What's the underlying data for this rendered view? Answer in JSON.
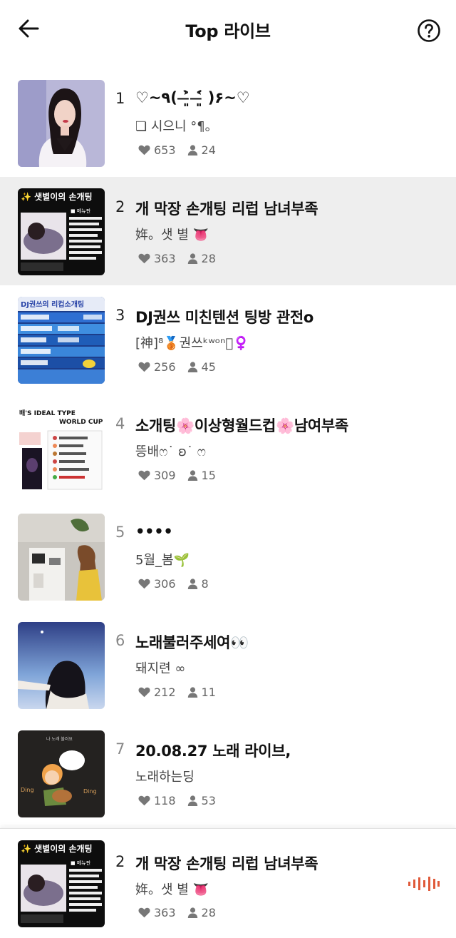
{
  "header": {
    "title": "Top 라이브"
  },
  "colors": {
    "highlight_bg": "#eeeeee",
    "stats_icon": "#777777",
    "equalizer": "#e05a3a"
  },
  "items": [
    {
      "rank": "1",
      "title": "♡~٩( ˃̶͈̀ ˂̶͈́ )۶~♡",
      "dj": "❏ 시으니          °¶｡",
      "likes": "653",
      "listeners": "24",
      "highlighted": false
    },
    {
      "rank": "2",
      "title": "개 막장 손개팅 리럽 남녀부족",
      "dj": "姩。샛 별 👅",
      "likes": "363",
      "listeners": "28",
      "highlighted": true
    },
    {
      "rank": "3",
      "title": "DJ권쓰 미친텐션 팅방 관전o",
      "dj": "[神]⁸🥉권쓰ᵏʷᵒⁿ🏻♀️",
      "likes": "256",
      "listeners": "45",
      "highlighted": false
    },
    {
      "rank": "4",
      "title": "소개팅🌸이상형월드컵🌸남여부족",
      "dj": "뜽배ෆ˙ ʚ˙ ෆ",
      "likes": "309",
      "listeners": "15",
      "highlighted": false
    },
    {
      "rank": "5",
      "title": "••••",
      "dj": "5월_봄🌱",
      "likes": "306",
      "listeners": "8",
      "highlighted": false
    },
    {
      "rank": "6",
      "title": "노래불러주세여👀",
      "dj": "돼지련          ∞",
      "likes": "212",
      "listeners": "11",
      "highlighted": false
    },
    {
      "rank": "7",
      "title": "20.08.27 노래 라이브,",
      "dj": "노래하는딩",
      "likes": "118",
      "listeners": "53",
      "highlighted": false
    }
  ],
  "thumb_text": {
    "t2_banner": "✨ 샛별이의 손개팅",
    "t2_menu": "■ 메뉴판",
    "t3_banner": "DJ권쓰의 리컵소개팅",
    "t4_top": "배'S IDEAL TYPE",
    "t4_sub": "WORLD CUP",
    "t7_top": "나 노래 불러요",
    "t7_ding1": "Ding",
    "t7_ding2": "Ding"
  },
  "mini_player": {
    "rank": "2",
    "title": "개 막장 손개팅 리럽 남녀부족",
    "dj": "姩。샛 별 👅",
    "likes": "363",
    "listeners": "28"
  }
}
